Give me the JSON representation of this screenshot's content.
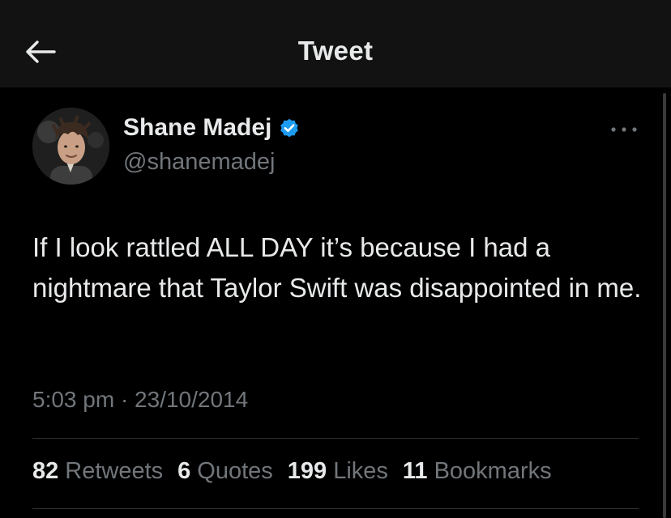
{
  "header": {
    "title": "Tweet",
    "back_icon": "arrow-left-icon"
  },
  "tweet": {
    "author": {
      "display_name": "Shane Madej",
      "handle": "@shanemadej",
      "verified": true,
      "verified_color": "#1d9bf0"
    },
    "text": "If I look rattled ALL DAY it’s because I had a nightmare that Taylor Swift was disappointed in me.",
    "timestamp": "5:03 pm · 23/10/2014",
    "more_icon": "ellipsis-icon"
  },
  "stats": {
    "retweets": {
      "count": "82",
      "label": "Retweets"
    },
    "quotes": {
      "count": "6",
      "label": "Quotes"
    },
    "likes": {
      "count": "199",
      "label": "Likes"
    },
    "bookmarks": {
      "count": "11",
      "label": "Bookmarks"
    }
  },
  "colors": {
    "background": "#000000",
    "header_background": "#121212",
    "primary_text": "#e7e9ea",
    "secondary_text": "#71767b",
    "divider": "#2f3336"
  }
}
